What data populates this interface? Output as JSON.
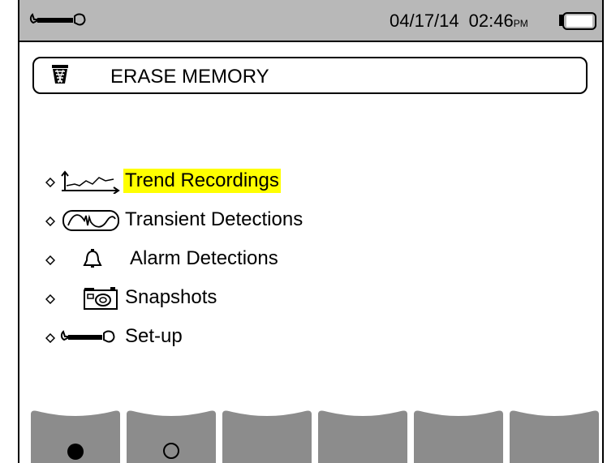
{
  "status_bar": {
    "tool_icon": "wrench-icon",
    "date": "04/17/14",
    "time": "02:46",
    "ampm": "PM",
    "battery_icon": "battery-icon"
  },
  "title": {
    "icon": "trash-icon",
    "text": "ERASE MEMORY"
  },
  "menu": {
    "items": [
      {
        "label": "Trend Recordings",
        "icon": "trend-icon",
        "selected": true
      },
      {
        "label": "Transient Detections",
        "icon": "transient-icon",
        "selected": false
      },
      {
        "label": "Alarm Detections",
        "icon": "bell-icon",
        "selected": false
      },
      {
        "label": "Snapshots",
        "icon": "camera-icon",
        "selected": false
      },
      {
        "label": "Set-up",
        "icon": "wrench-icon",
        "selected": false
      }
    ]
  },
  "function_keys": [
    {
      "symbol": "filled-circle-icon"
    },
    {
      "symbol": "open-circle-icon"
    },
    {
      "symbol": ""
    },
    {
      "symbol": ""
    },
    {
      "symbol": ""
    },
    {
      "symbol": ""
    }
  ],
  "colors": {
    "status_bar": "#b8b8b8",
    "selection_highlight": "#ffff00",
    "function_key": "#8c8c8c"
  }
}
